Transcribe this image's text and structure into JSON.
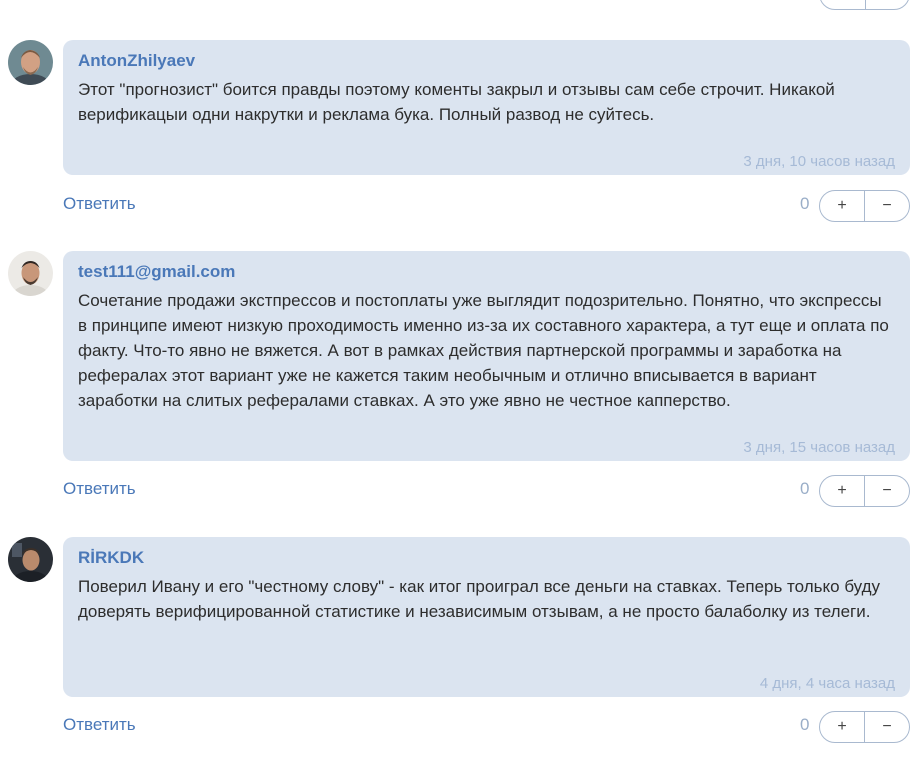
{
  "comments": [
    {
      "author": "AntonZhilyaev",
      "text": "Этот \"прогнозист\" боится правды поэтому коменты закрыл и отзывы сам себе строчит. Никакой верификацыи одни накрутки и реклама бука. Полный развод не суйтесь.",
      "time": "3 дня, 10 часов назад",
      "reply": "Ответить",
      "score": "0",
      "plus": "+",
      "minus": "−"
    },
    {
      "author": "test111@gmail.com",
      "text": "Сочетание продажи экстпрессов и постоплаты уже выглядит подозрительно. Понятно, что экспрессы в принципе имеют низкую проходимость именно из-за их составного характера, а тут еще и оплата по факту. Что-то явно не вяжется. А вот в рамках действия партнерской программы и заработка на рефералах этот вариант уже не кажется таким необычным и отлично вписывается в вариант заработки на слитых рефералами ставках. А это уже явно не честное капперство.",
      "time": "3 дня, 15 часов назад",
      "reply": "Ответить",
      "score": "0",
      "plus": "+",
      "minus": "−"
    },
    {
      "author": "RİRKDK",
      "text": "Поверил Ивану и его \"честному слову\" - как итог проиграл все деньги на ставках. Теперь только буду доверять верифицированной статистике и независимым отзывам, а не просто балаболку из телеги.",
      "time": "4 дня, 4 часа назад",
      "reply": "Ответить",
      "score": "0",
      "plus": "+",
      "minus": "−"
    }
  ],
  "colors": {
    "bubble": "#dbe4f0",
    "accent": "#4a78b8",
    "timestamp": "#a6bad6"
  }
}
